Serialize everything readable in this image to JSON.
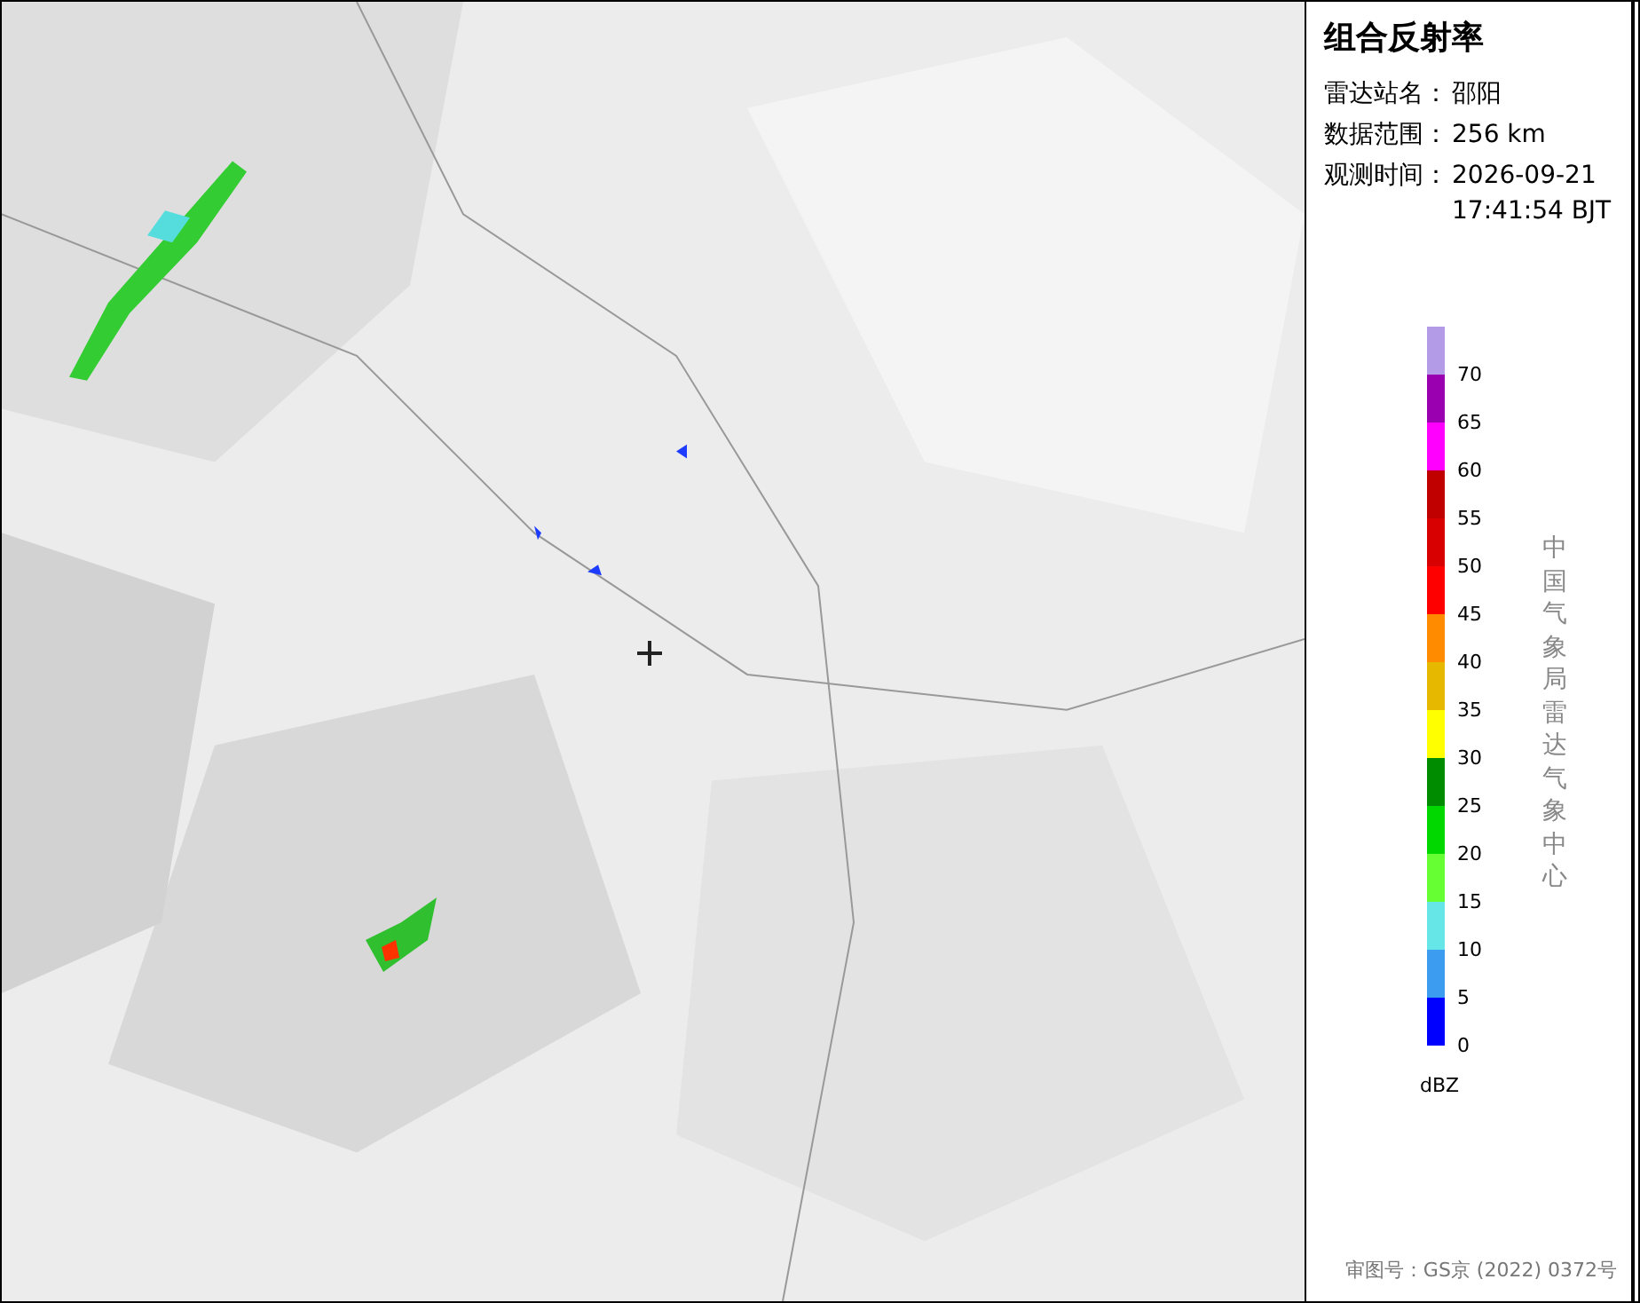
{
  "panel": {
    "title": "组合反射率",
    "info": [
      {
        "label": "雷达站名：",
        "value": "邵阳"
      },
      {
        "label": "数据范围：",
        "value": "256 km"
      },
      {
        "label": "观测时间：",
        "value": "2026-09-21\n17:41:54 BJT"
      }
    ],
    "legend": [
      {
        "color": "#b39be8",
        "label": "70"
      },
      {
        "color": "#9a00b0",
        "label": "65"
      },
      {
        "color": "#ff00ff",
        "label": "60"
      },
      {
        "color": "#c00000",
        "label": "55"
      },
      {
        "color": "#d80000",
        "label": "50"
      },
      {
        "color": "#ff0000",
        "label": "45"
      },
      {
        "color": "#ff8c00",
        "label": "40"
      },
      {
        "color": "#e6b800",
        "label": "35"
      },
      {
        "color": "#ffff00",
        "label": "30"
      },
      {
        "color": "#008c00",
        "label": "25"
      },
      {
        "color": "#00d800",
        "label": "20"
      },
      {
        "color": "#66ff33",
        "label": "15"
      },
      {
        "color": "#66e6e6",
        "label": "10"
      },
      {
        "color": "#3c9cf0",
        "label": "5"
      },
      {
        "color": "#0000ff",
        "label": "0"
      }
    ],
    "unit": "dBZ",
    "source": "中国气象局雷达气象中心",
    "footer": "审图号：GS京 (2022) 0372号"
  }
}
